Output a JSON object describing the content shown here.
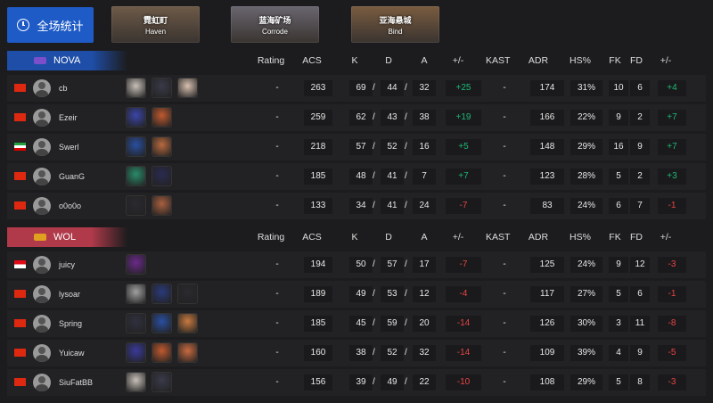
{
  "toolbar": {
    "all_stats_label": "全场统计"
  },
  "maps": [
    {
      "cn": "霓虹町",
      "en": "Haven",
      "bg": "#6e5a48"
    },
    {
      "cn": "蓝海矿场",
      "en": "Corrode",
      "bg": "#6a6670"
    },
    {
      "cn": "亚海悬城",
      "en": "Bind",
      "bg": "#7a5c40"
    }
  ],
  "headers": {
    "rating": "Rating",
    "acs": "ACS",
    "k": "K",
    "d": "D",
    "a": "A",
    "pm": "+/-",
    "kast": "KAST",
    "adr": "ADR",
    "hs": "HS%",
    "fk": "FK",
    "fd": "FD",
    "fpm": "+/-"
  },
  "slash": "/",
  "teams": [
    {
      "name": "NOVA",
      "color": "#1f4ea8",
      "logo_color": "#7a4fc9",
      "players": [
        {
          "name": "cb",
          "flag": "cn",
          "agents": [
            "#c8c0b8",
            "#3a3a4a",
            "#d8c0b0"
          ],
          "rating": "-",
          "acs": "263",
          "k": "69",
          "d": "44",
          "a": "32",
          "pm": "+25",
          "kast": "-",
          "adr": "174",
          "hs": "31%",
          "fk": "10",
          "fd": "6",
          "fpm": "+4"
        },
        {
          "name": "Ezeir",
          "flag": "cn",
          "agents": [
            "#3b45a8",
            "#c05a30"
          ],
          "rating": "-",
          "acs": "259",
          "k": "62",
          "d": "43",
          "a": "38",
          "pm": "+19",
          "kast": "-",
          "adr": "166",
          "hs": "22%",
          "fk": "9",
          "fd": "2",
          "fpm": "+7"
        },
        {
          "name": "Swerl",
          "flag": "ir",
          "agents": [
            "#2a4fa0",
            "#b86a40"
          ],
          "rating": "-",
          "acs": "218",
          "k": "57",
          "d": "52",
          "a": "16",
          "pm": "+5",
          "kast": "-",
          "adr": "148",
          "hs": "29%",
          "fk": "16",
          "fd": "9",
          "fpm": "+7"
        },
        {
          "name": "GuanG",
          "flag": "cn",
          "agents": [
            "#2a8a6a",
            "#2a2a50"
          ],
          "rating": "-",
          "acs": "185",
          "k": "48",
          "d": "41",
          "a": "7",
          "pm": "+7",
          "kast": "-",
          "adr": "123",
          "hs": "28%",
          "fk": "5",
          "fd": "2",
          "fpm": "+3"
        },
        {
          "name": "o0o0o",
          "flag": "cn",
          "agents": [
            "#2a2a30",
            "#a86040"
          ],
          "rating": "-",
          "acs": "133",
          "k": "34",
          "d": "41",
          "a": "24",
          "pm": "-7",
          "kast": "-",
          "adr": "83",
          "hs": "24%",
          "fk": "6",
          "fd": "7",
          "fpm": "-1"
        }
      ]
    },
    {
      "name": "WOL",
      "color": "#b03a4a",
      "logo_color": "#e0a020",
      "players": [
        {
          "name": "juicy",
          "flag": "id",
          "agents": [
            "#6a2a8a"
          ],
          "rating": "-",
          "acs": "194",
          "k": "50",
          "d": "57",
          "a": "17",
          "pm": "-7",
          "kast": "-",
          "adr": "125",
          "hs": "24%",
          "fk": "9",
          "fd": "12",
          "fpm": "-3"
        },
        {
          "name": "lysoar",
          "flag": "cn",
          "agents": [
            "#a0a0a0",
            "#2a3a7a",
            "#2a2a30"
          ],
          "rating": "-",
          "acs": "189",
          "k": "49",
          "d": "53",
          "a": "12",
          "pm": "-4",
          "kast": "-",
          "adr": "117",
          "hs": "27%",
          "fk": "5",
          "fd": "6",
          "fpm": "-1"
        },
        {
          "name": "Spring",
          "flag": "cn",
          "agents": [
            "#303040",
            "#2a4fa0",
            "#c87a40"
          ],
          "rating": "-",
          "acs": "185",
          "k": "45",
          "d": "59",
          "a": "20",
          "pm": "-14",
          "kast": "-",
          "adr": "126",
          "hs": "30%",
          "fk": "3",
          "fd": "11",
          "fpm": "-8"
        },
        {
          "name": "Yuicaw",
          "flag": "cn",
          "agents": [
            "#3a3a9a",
            "#c05a30",
            "#c86a40"
          ],
          "rating": "-",
          "acs": "160",
          "k": "38",
          "d": "52",
          "a": "32",
          "pm": "-14",
          "kast": "-",
          "adr": "109",
          "hs": "39%",
          "fk": "4",
          "fd": "9",
          "fpm": "-5"
        },
        {
          "name": "SiuFatBB",
          "flag": "hk",
          "agents": [
            "#c8c0b8",
            "#3a3a4a"
          ],
          "rating": "-",
          "acs": "156",
          "k": "39",
          "d": "49",
          "a": "22",
          "pm": "-10",
          "kast": "-",
          "adr": "108",
          "hs": "29%",
          "fk": "5",
          "fd": "8",
          "fpm": "-3"
        }
      ]
    }
  ]
}
